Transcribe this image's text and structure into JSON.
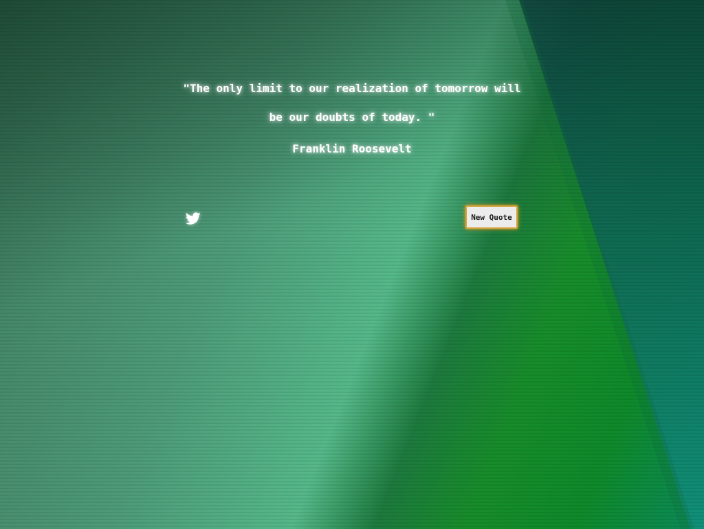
{
  "quote": {
    "text": "\"The only limit to our realization of tomorrow will be our doubts of today. \"",
    "author": "Franklin Roosevelt"
  },
  "actions": {
    "tweet_icon": "twitter-bird",
    "new_quote_label": "New Quote"
  },
  "colors": {
    "text": "#ffffff",
    "button_bg": "#ececec",
    "button_border": "#d8a23a",
    "bg_green": "#178c2a",
    "bg_mint": "#55b889",
    "bg_teal": "#0b8a5c"
  }
}
